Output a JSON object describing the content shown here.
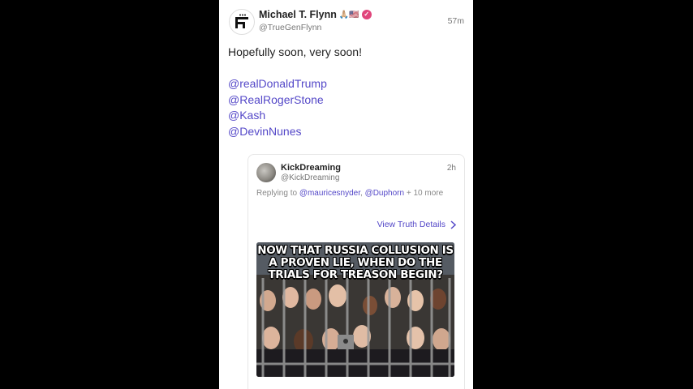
{
  "post": {
    "author_name": "Michael T. Flynn",
    "author_emoji": "🙏🏼🇺🇸",
    "handle": "@TrueGenFlynn",
    "time": "57m",
    "text_line1": "Hopefully soon, very soon!",
    "mentions": [
      "@realDonaldTrump",
      "@RealRogerStone",
      "@Kash",
      "@DevinNunes"
    ]
  },
  "quoted": {
    "author_name": "KickDreaming",
    "handle": "@KickDreaming",
    "time": "2h",
    "replying_prefix": "Replying to ",
    "replying_mention1": "@mauricesnyder",
    "replying_sep": ", ",
    "replying_mention2": "@Duphorn",
    "replying_suffix": " + 10 more",
    "view_details": "View Truth Details",
    "meme_title": "NOW THAT RUSSIA COLLUSION IS A PROVEN LIE, WHEN DO THE TRIALS FOR TREASON BEGIN?"
  },
  "colors": {
    "accent": "#5448c8",
    "verified": "#e0457b",
    "background": "#000000"
  },
  "icons": [
    "truth-social-logo-icon",
    "verified-badge-icon",
    "chevron-right-icon"
  ]
}
